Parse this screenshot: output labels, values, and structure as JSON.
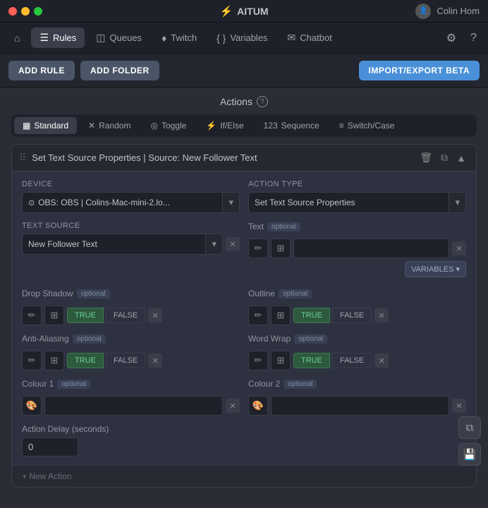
{
  "titlebar": {
    "title": "AITUM",
    "logo_symbol": "⚡",
    "user_name": "Colin Hom",
    "traffic": [
      "red",
      "yellow",
      "green"
    ]
  },
  "navbar": {
    "items": [
      {
        "label": "Home",
        "icon": "⌂",
        "active": false,
        "id": "home"
      },
      {
        "label": "Rules",
        "icon": "☰",
        "active": true,
        "id": "rules"
      },
      {
        "label": "Queues",
        "icon": "◫",
        "active": false,
        "id": "queues"
      },
      {
        "label": "Twitch",
        "icon": "♦",
        "active": false,
        "id": "twitch"
      },
      {
        "label": "Variables",
        "icon": "{ }",
        "active": false,
        "id": "variables"
      },
      {
        "label": "Chatbot",
        "icon": "✉",
        "active": false,
        "id": "chatbot"
      }
    ],
    "gear_icon": "⚙",
    "help_icon": "?"
  },
  "actionbar": {
    "add_rule_label": "ADD RULE",
    "add_folder_label": "ADD FOLDER",
    "import_export_label": "IMPORT/EXPORT BETA"
  },
  "actions_section": {
    "title": "Actions",
    "help_icon": "?"
  },
  "tabs": [
    {
      "label": "Standard",
      "icon": "▦",
      "active": true
    },
    {
      "label": "Random",
      "icon": "✕",
      "active": false
    },
    {
      "label": "Toggle",
      "icon": "◎",
      "active": false
    },
    {
      "label": "If/Else",
      "icon": "⚡",
      "active": false
    },
    {
      "label": "Sequence",
      "icon": "123",
      "active": false
    },
    {
      "label": "Switch/Case",
      "icon": "≡",
      "active": false
    }
  ],
  "card": {
    "title": "Set Text Source Properties | Source: New Follower Text",
    "device_label": "Device",
    "device_value": "OBS: OBS | Colins-Mac-mini-2.lo...",
    "action_type_label": "Action Type",
    "action_type_value": "Set Text Source Properties",
    "text_source_label": "Text Source",
    "text_source_value": "New Follower Text",
    "text_label": "Text",
    "text_optional": "optional",
    "drop_shadow_label": "Drop Shadow",
    "drop_shadow_optional": "optional",
    "drop_shadow_true": "TRUE",
    "drop_shadow_false": "FALSE",
    "outline_label": "Outline",
    "outline_optional": "optional",
    "outline_true": "TRUE",
    "outline_false": "FALSE",
    "anti_aliasing_label": "Anti-Aliasing",
    "anti_aliasing_optional": "optional",
    "anti_aliasing_true": "TRUE",
    "anti_aliasing_false": "FALSE",
    "word_wrap_label": "Word Wrap",
    "word_wrap_optional": "optional",
    "word_wrap_true": "TRUE",
    "word_wrap_false": "FALSE",
    "colour1_label": "Colour 1",
    "colour1_optional": "optional",
    "colour2_label": "Colour 2",
    "colour2_optional": "optional",
    "action_delay_label": "Action Delay (seconds)",
    "action_delay_value": "0",
    "variables_btn": "VARIABLES ▾"
  }
}
